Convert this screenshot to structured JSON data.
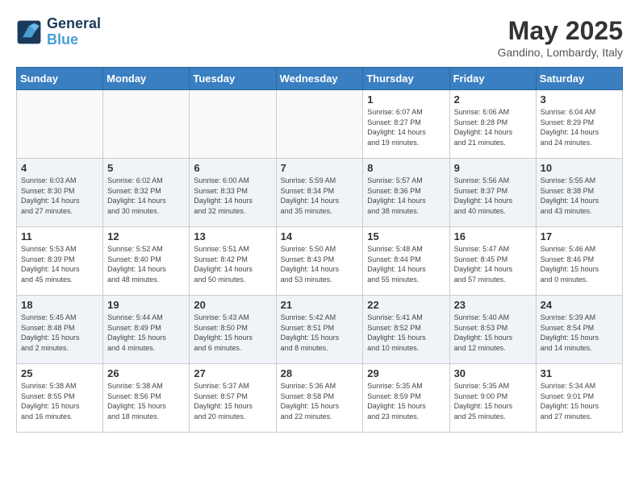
{
  "logo": {
    "line1": "General",
    "line2": "Blue"
  },
  "title": "May 2025",
  "location": "Gandino, Lombardy, Italy",
  "weekdays": [
    "Sunday",
    "Monday",
    "Tuesday",
    "Wednesday",
    "Thursday",
    "Friday",
    "Saturday"
  ],
  "weeks": [
    [
      {
        "day": "",
        "info": ""
      },
      {
        "day": "",
        "info": ""
      },
      {
        "day": "",
        "info": ""
      },
      {
        "day": "",
        "info": ""
      },
      {
        "day": "1",
        "info": "Sunrise: 6:07 AM\nSunset: 8:27 PM\nDaylight: 14 hours\nand 19 minutes."
      },
      {
        "day": "2",
        "info": "Sunrise: 6:06 AM\nSunset: 8:28 PM\nDaylight: 14 hours\nand 21 minutes."
      },
      {
        "day": "3",
        "info": "Sunrise: 6:04 AM\nSunset: 8:29 PM\nDaylight: 14 hours\nand 24 minutes."
      }
    ],
    [
      {
        "day": "4",
        "info": "Sunrise: 6:03 AM\nSunset: 8:30 PM\nDaylight: 14 hours\nand 27 minutes."
      },
      {
        "day": "5",
        "info": "Sunrise: 6:02 AM\nSunset: 8:32 PM\nDaylight: 14 hours\nand 30 minutes."
      },
      {
        "day": "6",
        "info": "Sunrise: 6:00 AM\nSunset: 8:33 PM\nDaylight: 14 hours\nand 32 minutes."
      },
      {
        "day": "7",
        "info": "Sunrise: 5:59 AM\nSunset: 8:34 PM\nDaylight: 14 hours\nand 35 minutes."
      },
      {
        "day": "8",
        "info": "Sunrise: 5:57 AM\nSunset: 8:36 PM\nDaylight: 14 hours\nand 38 minutes."
      },
      {
        "day": "9",
        "info": "Sunrise: 5:56 AM\nSunset: 8:37 PM\nDaylight: 14 hours\nand 40 minutes."
      },
      {
        "day": "10",
        "info": "Sunrise: 5:55 AM\nSunset: 8:38 PM\nDaylight: 14 hours\nand 43 minutes."
      }
    ],
    [
      {
        "day": "11",
        "info": "Sunrise: 5:53 AM\nSunset: 8:39 PM\nDaylight: 14 hours\nand 45 minutes."
      },
      {
        "day": "12",
        "info": "Sunrise: 5:52 AM\nSunset: 8:40 PM\nDaylight: 14 hours\nand 48 minutes."
      },
      {
        "day": "13",
        "info": "Sunrise: 5:51 AM\nSunset: 8:42 PM\nDaylight: 14 hours\nand 50 minutes."
      },
      {
        "day": "14",
        "info": "Sunrise: 5:50 AM\nSunset: 8:43 PM\nDaylight: 14 hours\nand 53 minutes."
      },
      {
        "day": "15",
        "info": "Sunrise: 5:48 AM\nSunset: 8:44 PM\nDaylight: 14 hours\nand 55 minutes."
      },
      {
        "day": "16",
        "info": "Sunrise: 5:47 AM\nSunset: 8:45 PM\nDaylight: 14 hours\nand 57 minutes."
      },
      {
        "day": "17",
        "info": "Sunrise: 5:46 AM\nSunset: 8:46 PM\nDaylight: 15 hours\nand 0 minutes."
      }
    ],
    [
      {
        "day": "18",
        "info": "Sunrise: 5:45 AM\nSunset: 8:48 PM\nDaylight: 15 hours\nand 2 minutes."
      },
      {
        "day": "19",
        "info": "Sunrise: 5:44 AM\nSunset: 8:49 PM\nDaylight: 15 hours\nand 4 minutes."
      },
      {
        "day": "20",
        "info": "Sunrise: 5:43 AM\nSunset: 8:50 PM\nDaylight: 15 hours\nand 6 minutes."
      },
      {
        "day": "21",
        "info": "Sunrise: 5:42 AM\nSunset: 8:51 PM\nDaylight: 15 hours\nand 8 minutes."
      },
      {
        "day": "22",
        "info": "Sunrise: 5:41 AM\nSunset: 8:52 PM\nDaylight: 15 hours\nand 10 minutes."
      },
      {
        "day": "23",
        "info": "Sunrise: 5:40 AM\nSunset: 8:53 PM\nDaylight: 15 hours\nand 12 minutes."
      },
      {
        "day": "24",
        "info": "Sunrise: 5:39 AM\nSunset: 8:54 PM\nDaylight: 15 hours\nand 14 minutes."
      }
    ],
    [
      {
        "day": "25",
        "info": "Sunrise: 5:38 AM\nSunset: 8:55 PM\nDaylight: 15 hours\nand 16 minutes."
      },
      {
        "day": "26",
        "info": "Sunrise: 5:38 AM\nSunset: 8:56 PM\nDaylight: 15 hours\nand 18 minutes."
      },
      {
        "day": "27",
        "info": "Sunrise: 5:37 AM\nSunset: 8:57 PM\nDaylight: 15 hours\nand 20 minutes."
      },
      {
        "day": "28",
        "info": "Sunrise: 5:36 AM\nSunset: 8:58 PM\nDaylight: 15 hours\nand 22 minutes."
      },
      {
        "day": "29",
        "info": "Sunrise: 5:35 AM\nSunset: 8:59 PM\nDaylight: 15 hours\nand 23 minutes."
      },
      {
        "day": "30",
        "info": "Sunrise: 5:35 AM\nSunset: 9:00 PM\nDaylight: 15 hours\nand 25 minutes."
      },
      {
        "day": "31",
        "info": "Sunrise: 5:34 AM\nSunset: 9:01 PM\nDaylight: 15 hours\nand 27 minutes."
      }
    ]
  ]
}
